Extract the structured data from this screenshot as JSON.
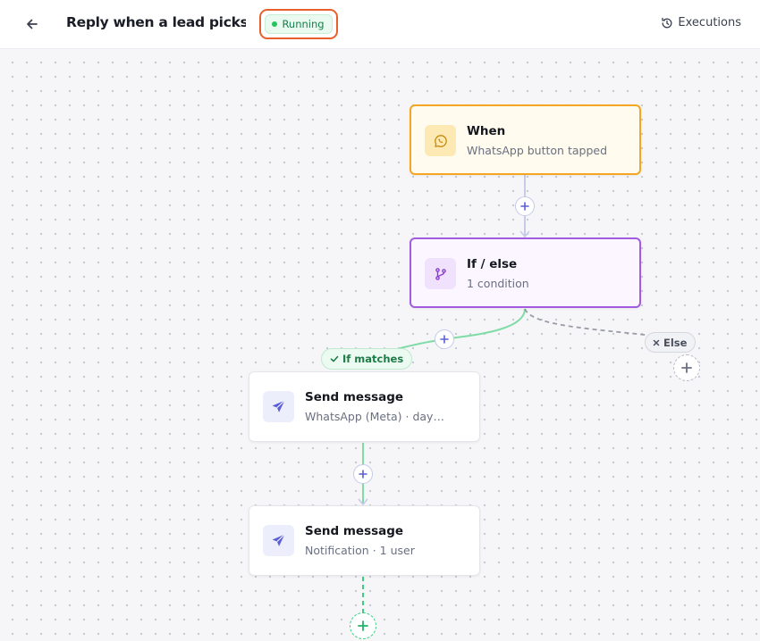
{
  "header": {
    "title": "Reply when a lead picks a choice",
    "status": "Running",
    "executions_label": "Executions"
  },
  "nodes": {
    "trigger": {
      "title": "When",
      "subtitle": "WhatsApp button tapped",
      "icon": "whatsapp-icon"
    },
    "ifelse": {
      "title": "If / else",
      "subtitle": "1 condition",
      "icon": "branch-icon"
    },
    "send1": {
      "title": "Send message",
      "subtitle": "WhatsApp (Meta) · day…",
      "icon": "send-icon"
    },
    "send2": {
      "title": "Send message",
      "subtitle": "Notification · 1 user",
      "icon": "send-icon"
    }
  },
  "branches": {
    "match_label": "If matches",
    "else_label": "Else"
  },
  "colors": {
    "accent_status": "#e8612c",
    "trigger_border": "#f4a623",
    "ifelse_border": "#a15ce0",
    "match_line": "#7fdca6",
    "else_line": "#9a9da8"
  }
}
